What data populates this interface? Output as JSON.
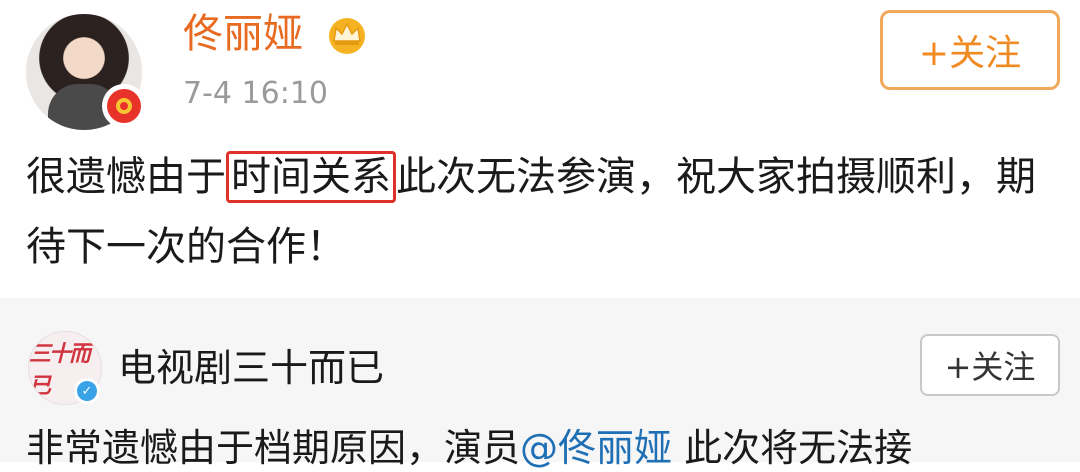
{
  "post1": {
    "username": "佟丽娅",
    "time": "7-4 16:10",
    "follow_label": "+关注",
    "content_before": "很遗憾由于",
    "content_highlight": "时间关系",
    "content_after": "此次无法参演，祝大家拍摄顺利，期待下一次的合作！"
  },
  "post2": {
    "username": "电视剧三十而已",
    "avatar_text": "三十而已",
    "follow_label": "+关注",
    "content_before": "非常遗憾由于档期原因，演员",
    "mention": "@佟丽娅",
    "content_after": " 此次将无法接"
  },
  "colors": {
    "username_orange": "#e86a20",
    "follow_orange": "#f08a22",
    "highlight_red": "#e0302a",
    "mention_blue": "#1f6fb5"
  },
  "icons": [
    "crown-icon",
    "verified-badge-icon"
  ]
}
